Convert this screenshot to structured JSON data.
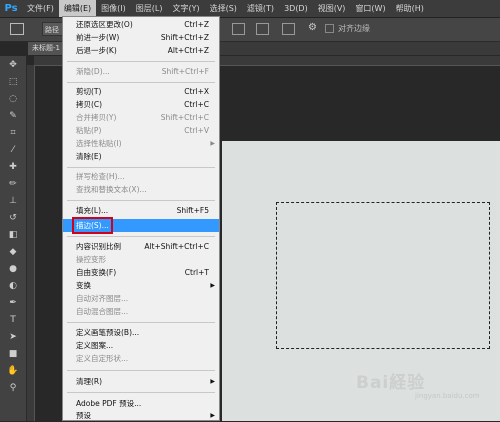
{
  "app": {
    "logo": "Ps"
  },
  "menubar": {
    "items": [
      {
        "label": "文件(F)"
      },
      {
        "label": "编辑(E)",
        "active": true
      },
      {
        "label": "图像(I)"
      },
      {
        "label": "图层(L)"
      },
      {
        "label": "文字(Y)"
      },
      {
        "label": "选择(S)"
      },
      {
        "label": "滤镜(T)"
      },
      {
        "label": "3D(D)"
      },
      {
        "label": "视图(V)"
      },
      {
        "label": "窗口(W)"
      },
      {
        "label": "帮助(H)"
      }
    ]
  },
  "options": {
    "box_label": "路径",
    "antialias_label": "对齐边缘"
  },
  "document": {
    "tab_label": "未标题-1"
  },
  "edit_menu": {
    "items": [
      {
        "label": "还原选区更改(O)",
        "shortcut": "Ctrl+Z"
      },
      {
        "label": "前进一步(W)",
        "shortcut": "Shift+Ctrl+Z"
      },
      {
        "label": "后退一步(K)",
        "shortcut": "Alt+Ctrl+Z"
      },
      {
        "label": "渐隐(D)...",
        "shortcut": "Shift+Ctrl+F",
        "disabled": true
      },
      {
        "label": "剪切(T)",
        "shortcut": "Ctrl+X"
      },
      {
        "label": "拷贝(C)",
        "shortcut": "Ctrl+C"
      },
      {
        "label": "合并拷贝(Y)",
        "shortcut": "Shift+Ctrl+C",
        "disabled": true
      },
      {
        "label": "粘贴(P)",
        "shortcut": "Ctrl+V",
        "disabled": true
      },
      {
        "label": "选择性粘贴(I)",
        "shortcut": "",
        "disabled": true
      },
      {
        "label": "清除(E)",
        "shortcut": ""
      },
      {
        "label": "拼写检查(H)...",
        "shortcut": "",
        "disabled": true
      },
      {
        "label": "查找和替换文本(X)...",
        "shortcut": "",
        "disabled": true
      },
      {
        "label": "填充(L)...",
        "shortcut": "Shift+F5"
      },
      {
        "label": "描边(S)...",
        "shortcut": "",
        "highlighted": true
      },
      {
        "label": "内容识别比例",
        "shortcut": "Alt+Shift+Ctrl+C"
      },
      {
        "label": "操控变形",
        "shortcut": "",
        "disabled": true
      },
      {
        "label": "自由变换(F)",
        "shortcut": "Ctrl+T"
      },
      {
        "label": "变换",
        "shortcut": ""
      },
      {
        "label": "自动对齐图层...",
        "shortcut": "",
        "disabled": true
      },
      {
        "label": "自动混合图层...",
        "shortcut": "",
        "disabled": true
      },
      {
        "label": "定义画笔预设(B)...",
        "shortcut": ""
      },
      {
        "label": "定义图案...",
        "shortcut": ""
      },
      {
        "label": "定义自定形状...",
        "shortcut": "",
        "disabled": true
      },
      {
        "label": "清理(R)",
        "shortcut": ""
      },
      {
        "label": "Adobe PDF 预设...",
        "shortcut": ""
      },
      {
        "label": "预设",
        "shortcut": ""
      }
    ]
  },
  "watermark": {
    "text": "Bai経验",
    "sub": "jingyan.baidu.com"
  },
  "colors": {
    "highlight": "#3399ff",
    "callout": "#d0021b",
    "canvas": "#dce1e0"
  }
}
